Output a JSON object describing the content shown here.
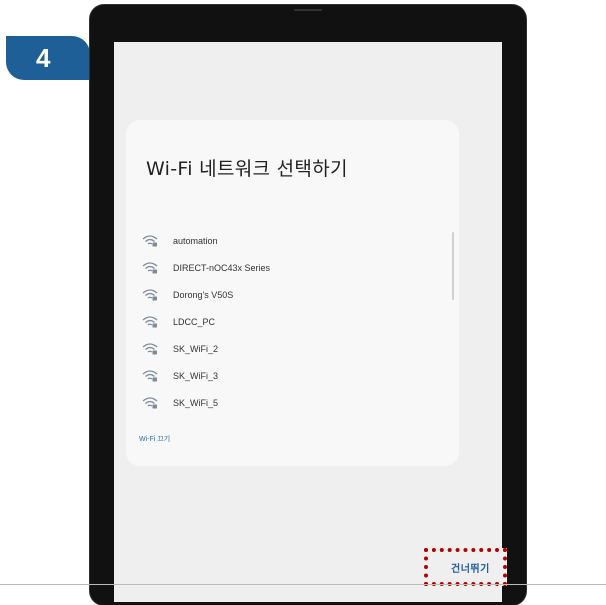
{
  "step": {
    "number": "4",
    "color": "#1f5f97"
  },
  "dialog": {
    "title": "Wi-Fi 네트워크 선택하기",
    "networks": [
      {
        "name": "automation",
        "icon": "wifi-lock-icon"
      },
      {
        "name": "DIRECT-nOC43x Series",
        "icon": "wifi-lock-icon"
      },
      {
        "name": "Dorong's V50S",
        "icon": "wifi-lock-icon"
      },
      {
        "name": "LDCC_PC",
        "icon": "wifi-lock-icon"
      },
      {
        "name": "SK_WiFi_2",
        "icon": "wifi-lock-icon"
      },
      {
        "name": "SK_WiFi_3",
        "icon": "wifi-lock-icon"
      },
      {
        "name": "SK_WiFi_5",
        "icon": "wifi-lock-icon"
      }
    ],
    "wifi_off_label": "Wi-Fi 끄기"
  },
  "footer": {
    "skip_label": "건너뛰기"
  },
  "colors": {
    "accent": "#1d5d9c",
    "highlight": "#b80000",
    "screen_bg": "#efefef"
  }
}
